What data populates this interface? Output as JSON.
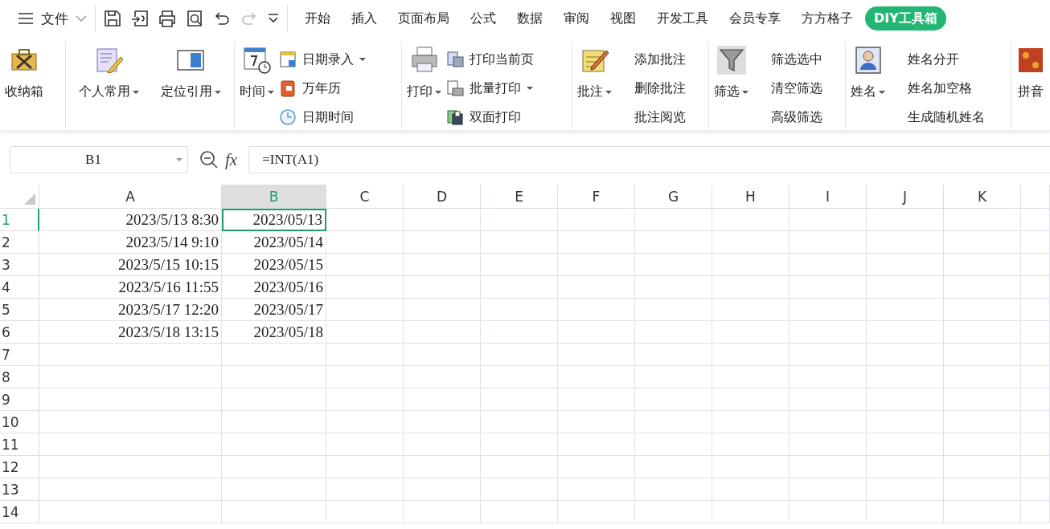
{
  "menu": {
    "file_label": "文件"
  },
  "tabs": [
    {
      "label": "开始",
      "selected": false
    },
    {
      "label": "插入",
      "selected": false
    },
    {
      "label": "页面布局",
      "selected": false
    },
    {
      "label": "公式",
      "selected": false
    },
    {
      "label": "数据",
      "selected": false
    },
    {
      "label": "审阅",
      "selected": false
    },
    {
      "label": "视图",
      "selected": false
    },
    {
      "label": "开发工具",
      "selected": false
    },
    {
      "label": "会员专享",
      "selected": false
    },
    {
      "label": "方方格子",
      "selected": false
    },
    {
      "label": "DIY工具箱",
      "selected": true
    }
  ],
  "ribbon_groups": [
    {
      "large": [
        {
          "label": "收纳箱",
          "has_menu": false
        }
      ]
    },
    {
      "large": [
        {
          "label": "个人常用",
          "has_menu": true
        },
        {
          "label": "定位引用",
          "has_menu": true
        }
      ]
    },
    {
      "large": [
        {
          "label": "时间",
          "has_menu": true
        }
      ],
      "small": [
        {
          "label": "日期录入",
          "has_menu": true
        },
        {
          "label": "万年历",
          "has_menu": false
        },
        {
          "label": "日期时间",
          "has_menu": false
        }
      ]
    },
    {
      "large": [
        {
          "label": "打印",
          "has_menu": true
        }
      ],
      "small": [
        {
          "label": "打印当前页",
          "has_menu": false
        },
        {
          "label": "批量打印",
          "has_menu": true
        },
        {
          "label": "双面打印",
          "has_menu": false
        }
      ]
    },
    {
      "large": [
        {
          "label": "批注",
          "has_menu": true
        }
      ],
      "small": [
        {
          "label": "添加批注",
          "has_menu": false
        },
        {
          "label": "删除批注",
          "has_menu": false
        },
        {
          "label": "批注阅览",
          "has_menu": false
        }
      ]
    },
    {
      "large": [
        {
          "label": "筛选",
          "has_menu": true
        }
      ],
      "small": [
        {
          "label": "筛选选中",
          "has_menu": false
        },
        {
          "label": "清空筛选",
          "has_menu": false
        },
        {
          "label": "高级筛选",
          "has_menu": false
        }
      ]
    },
    {
      "large": [
        {
          "label": "姓名",
          "has_menu": true
        }
      ],
      "small": [
        {
          "label": "姓名分开",
          "has_menu": false
        },
        {
          "label": "姓名加空格",
          "has_menu": false
        },
        {
          "label": "生成随机姓名",
          "has_menu": false
        }
      ]
    },
    {
      "large": [
        {
          "label": "拼音",
          "has_menu": false
        }
      ]
    }
  ],
  "formula_bar": {
    "name_box": "B1",
    "function_label": "fx",
    "formula": "=INT(A1)"
  },
  "sheet": {
    "columns": [
      {
        "label": "A",
        "selected": false
      },
      {
        "label": "B",
        "selected": true
      },
      {
        "label": "C",
        "selected": false
      },
      {
        "label": "D",
        "selected": false
      },
      {
        "label": "E",
        "selected": false
      },
      {
        "label": "F",
        "selected": false
      },
      {
        "label": "G",
        "selected": false
      },
      {
        "label": "H",
        "selected": false
      },
      {
        "label": "I",
        "selected": false
      },
      {
        "label": "J",
        "selected": false
      },
      {
        "label": "K",
        "selected": false
      }
    ],
    "rows": [
      {
        "header": "1",
        "selected": true,
        "cells": [
          {
            "text": "2023/5/13 8:30",
            "active": false
          },
          {
            "text": "2023/05/13",
            "active": true
          }
        ]
      },
      {
        "header": "2",
        "selected": false,
        "cells": [
          {
            "text": "2023/5/14 9:10",
            "active": false
          },
          {
            "text": "2023/05/14",
            "active": false
          }
        ]
      },
      {
        "header": "3",
        "selected": false,
        "cells": [
          {
            "text": "2023/5/15 10:15",
            "active": false
          },
          {
            "text": "2023/05/15",
            "active": false
          }
        ]
      },
      {
        "header": "4",
        "selected": false,
        "cells": [
          {
            "text": "2023/5/16 11:55",
            "active": false
          },
          {
            "text": "2023/05/16",
            "active": false
          }
        ]
      },
      {
        "header": "5",
        "selected": false,
        "cells": [
          {
            "text": "2023/5/17 12:20",
            "active": false
          },
          {
            "text": "2023/05/17",
            "active": false
          }
        ]
      },
      {
        "header": "6",
        "selected": false,
        "cells": [
          {
            "text": "2023/5/18 13:15",
            "active": false
          },
          {
            "text": "2023/05/18",
            "active": false
          }
        ]
      },
      {
        "header": "7",
        "selected": false
      },
      {
        "header": "8",
        "selected": false
      },
      {
        "header": "9",
        "selected": false
      },
      {
        "header": "10",
        "selected": false
      },
      {
        "header": "11",
        "selected": false
      },
      {
        "header": "12",
        "selected": false
      },
      {
        "header": "13",
        "selected": false
      },
      {
        "header": "14",
        "selected": false
      }
    ]
  }
}
